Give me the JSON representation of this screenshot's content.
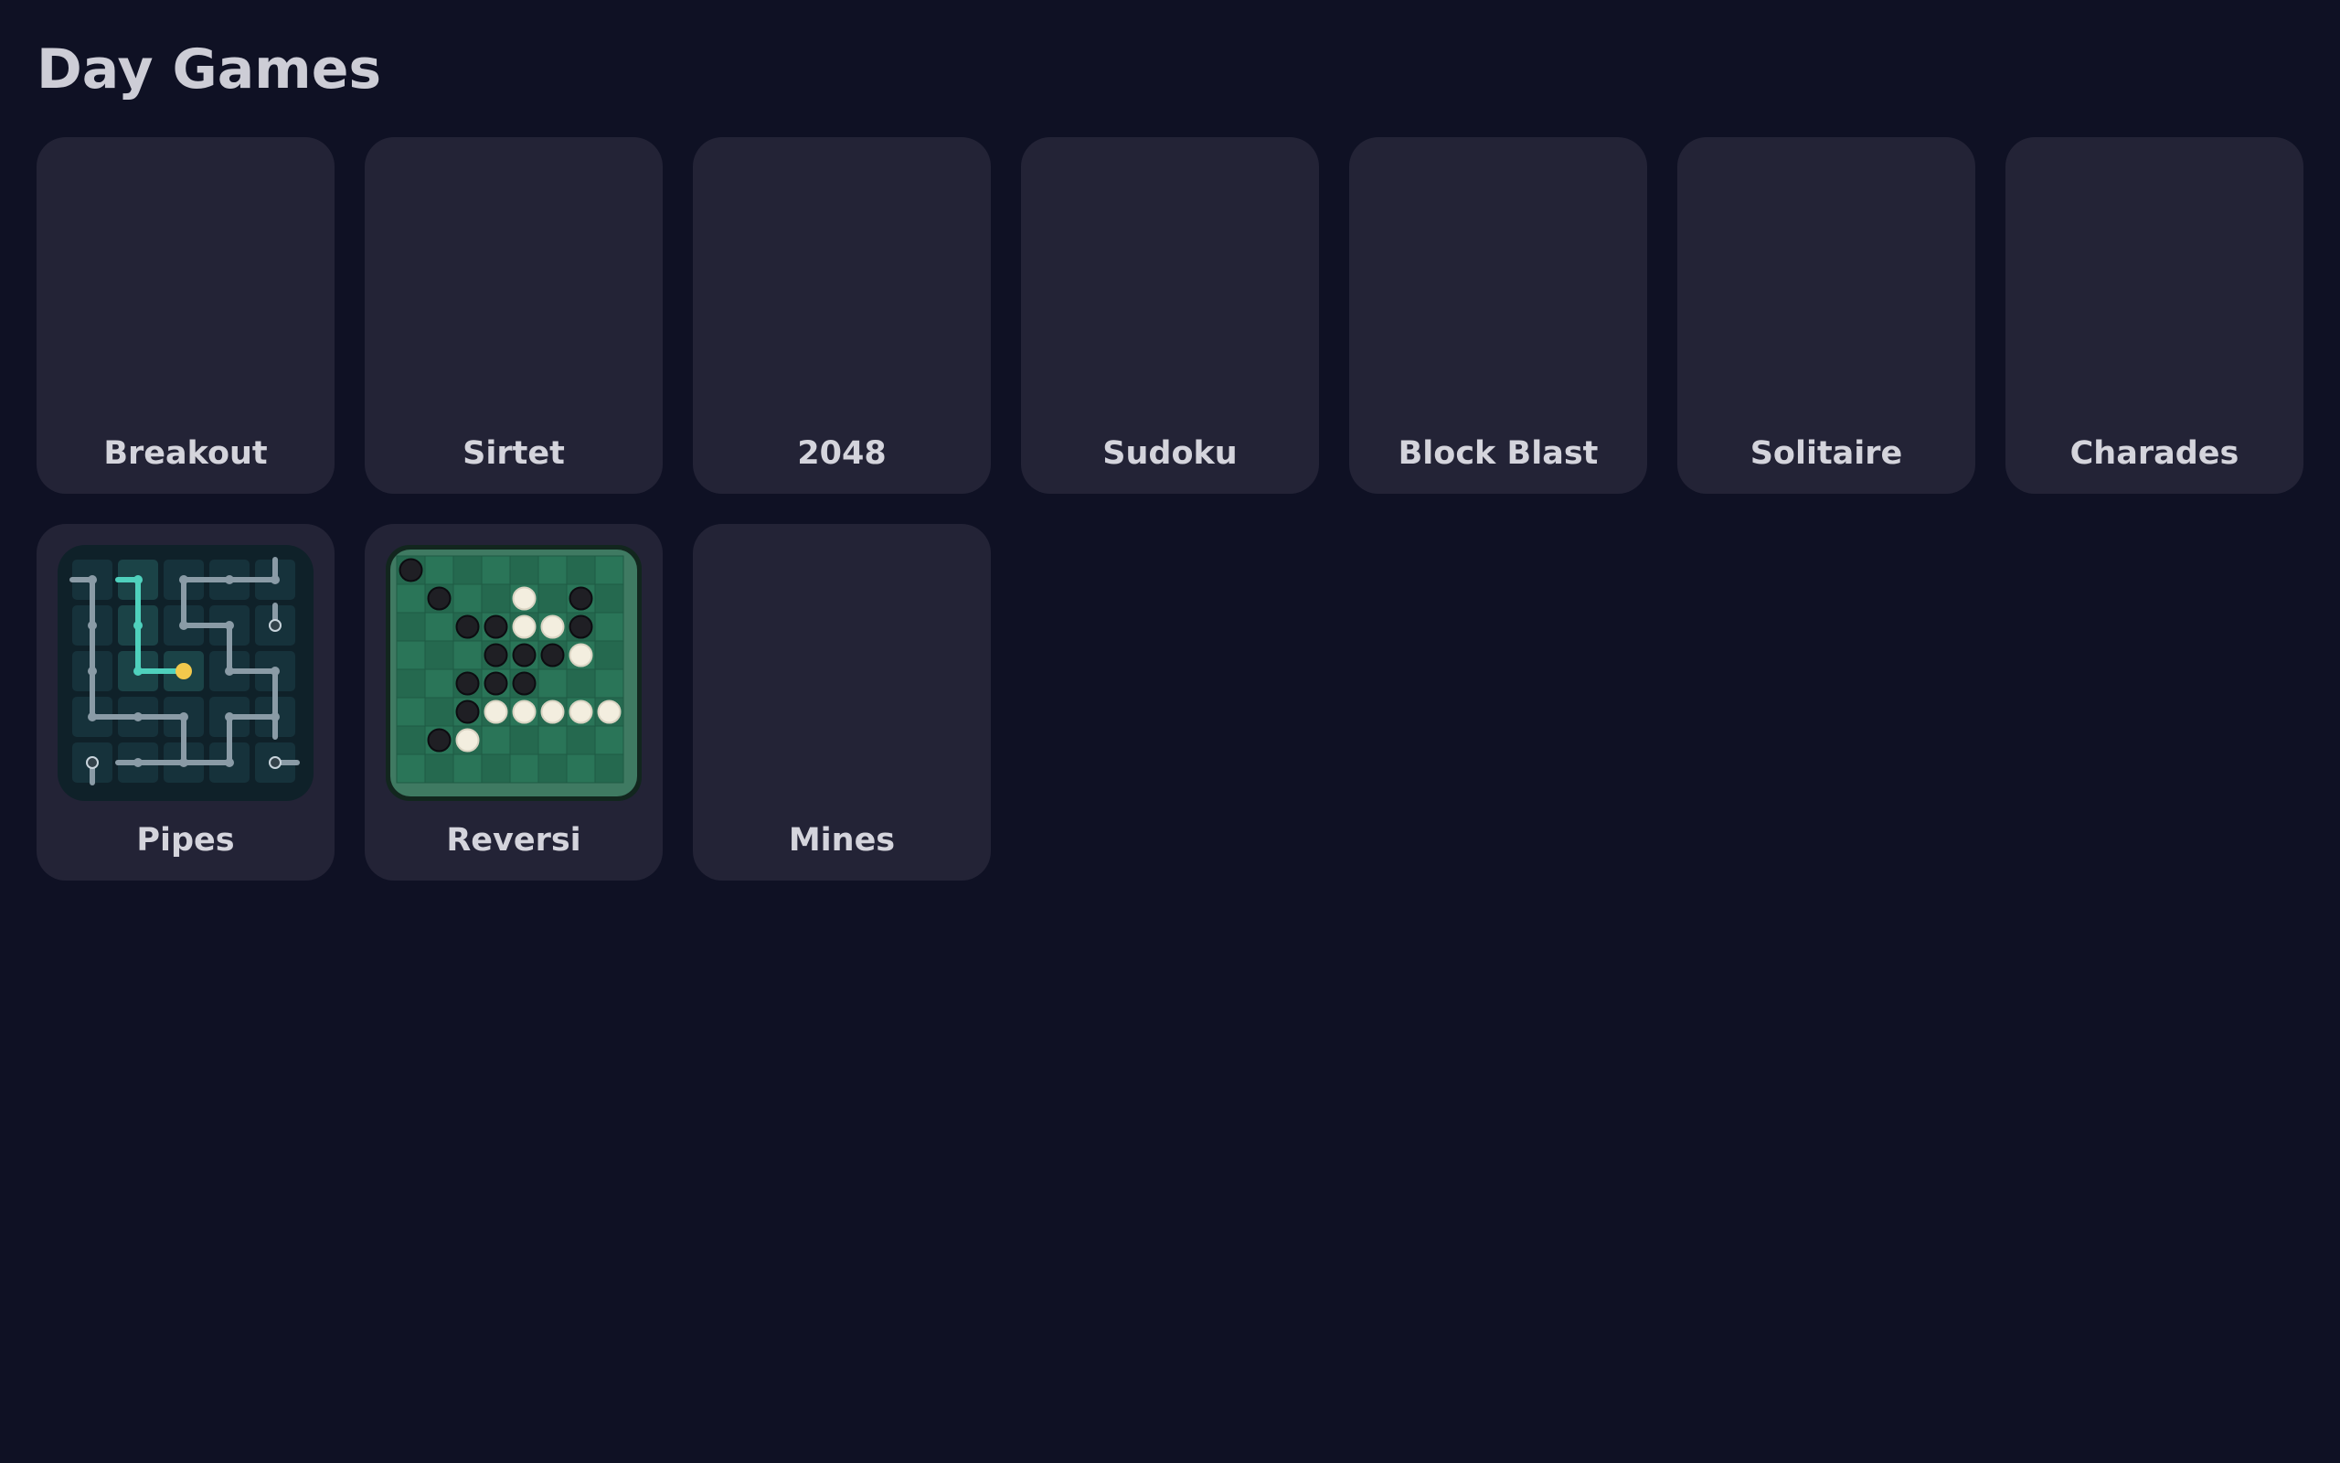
{
  "page": {
    "title": "Day Games"
  },
  "colors": {
    "background": "#0f1124",
    "card": "#232336",
    "label": "#d4d4dc",
    "pipes_active": "#4fd1bd",
    "pipes_source": "#f2c94c",
    "reversi_board": "#246b50"
  },
  "games": [
    {
      "id": "breakout",
      "label": "Breakout",
      "has_thumbnail": false
    },
    {
      "id": "sirtet",
      "label": "Sirtet",
      "has_thumbnail": false
    },
    {
      "id": "2048",
      "label": "2048",
      "has_thumbnail": false
    },
    {
      "id": "sudoku",
      "label": "Sudoku",
      "has_thumbnail": false
    },
    {
      "id": "block-blast",
      "label": "Block Blast",
      "has_thumbnail": false
    },
    {
      "id": "solitaire",
      "label": "Solitaire",
      "has_thumbnail": false
    },
    {
      "id": "charades",
      "label": "Charades",
      "has_thumbnail": false
    },
    {
      "id": "pipes",
      "label": "Pipes",
      "has_thumbnail": true,
      "thumbnail_icon": "pipes-puzzle-icon"
    },
    {
      "id": "reversi",
      "label": "Reversi",
      "has_thumbnail": true,
      "thumbnail_icon": "reversi-board-icon"
    },
    {
      "id": "mines",
      "label": "Mines",
      "has_thumbnail": false
    }
  ],
  "reversi_pieces": {
    "black": [
      [
        0,
        0
      ],
      [
        1,
        1
      ],
      [
        1,
        6
      ],
      [
        2,
        2
      ],
      [
        2,
        3
      ],
      [
        2,
        6
      ],
      [
        3,
        3
      ],
      [
        3,
        4
      ],
      [
        3,
        5
      ],
      [
        4,
        2
      ],
      [
        4,
        3
      ],
      [
        4,
        4
      ],
      [
        5,
        2
      ],
      [
        6,
        1
      ]
    ],
    "white": [
      [
        1,
        4
      ],
      [
        2,
        4
      ],
      [
        2,
        5
      ],
      [
        3,
        6
      ],
      [
        5,
        3
      ],
      [
        5,
        4
      ],
      [
        5,
        5
      ],
      [
        5,
        6
      ],
      [
        5,
        7
      ],
      [
        6,
        2
      ]
    ]
  }
}
